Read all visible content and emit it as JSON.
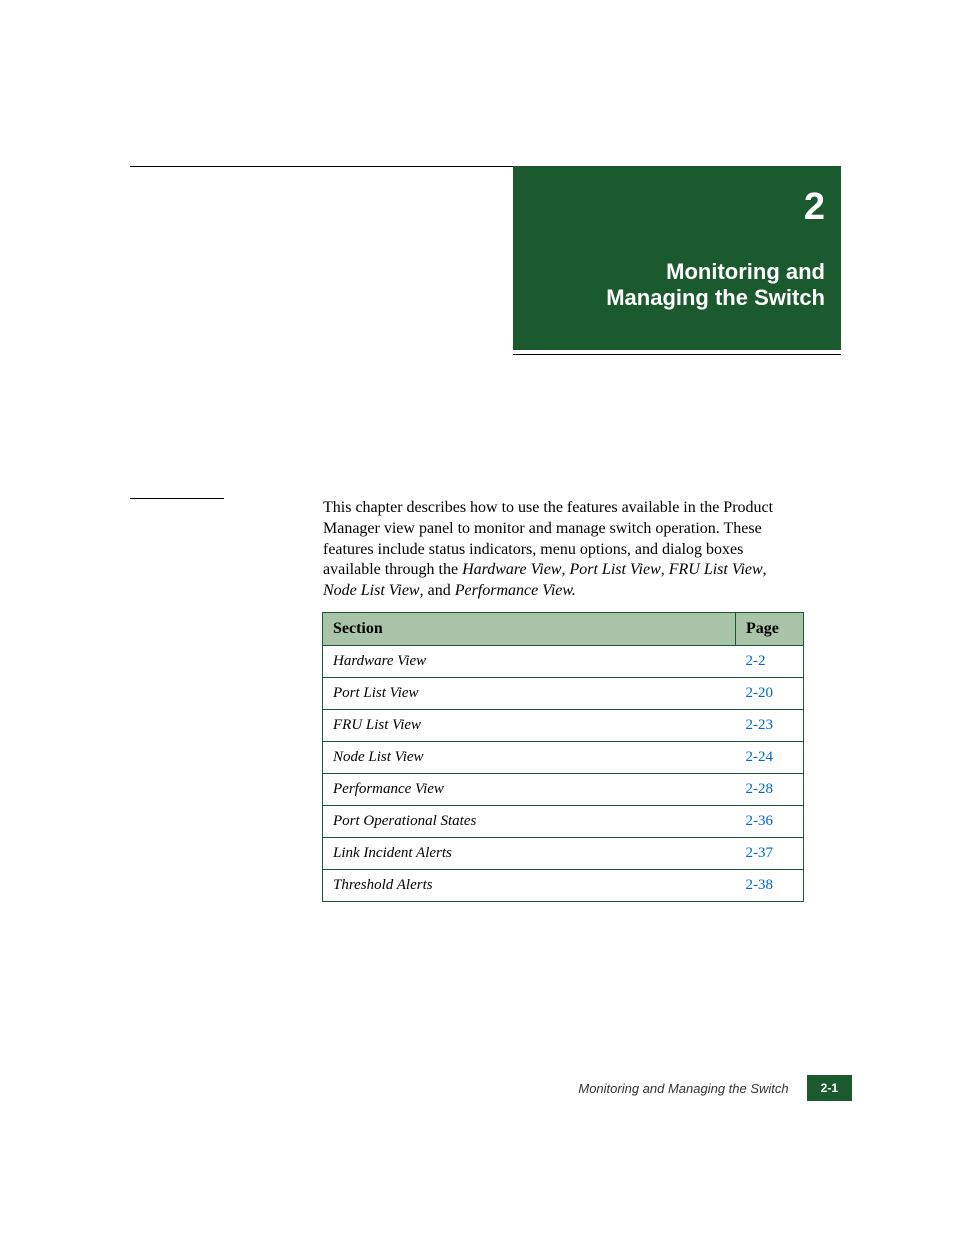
{
  "chapter": {
    "number": "2",
    "title_line1": "Monitoring and",
    "title_line2": "Managing the Switch"
  },
  "body": {
    "p1_part1": "This chapter describes how to use the features available in the Product Manager view panel to monitor and manage switch operation. These features include status indicators, menu options, and dialog boxes available through the ",
    "hw": "Hardware View",
    "sep1": ", ",
    "plv": "Port List View",
    "sep2": ", ",
    "flv": "FRU List View",
    "sep3": ", ",
    "nlv": "Node List View",
    "sep4": ", and ",
    "pv": "Performance View.",
    "end": ""
  },
  "table": {
    "header_section": "Section",
    "header_page": "Page",
    "rows": [
      {
        "section": "Hardware View",
        "page": "2-2"
      },
      {
        "section": "Port List View",
        "page": "2-20"
      },
      {
        "section": "FRU List View",
        "page": "2-23"
      },
      {
        "section": "Node List View",
        "page": "2-24"
      },
      {
        "section": "Performance View",
        "page": "2-28"
      },
      {
        "section": "Port Operational States",
        "page": "2-36"
      },
      {
        "section": "Link Incident Alerts",
        "page": "2-37"
      },
      {
        "section": "Threshold Alerts",
        "page": "2-38"
      }
    ]
  },
  "footer": {
    "text": "Monitoring and Managing the Switch",
    "page": "2-1"
  }
}
